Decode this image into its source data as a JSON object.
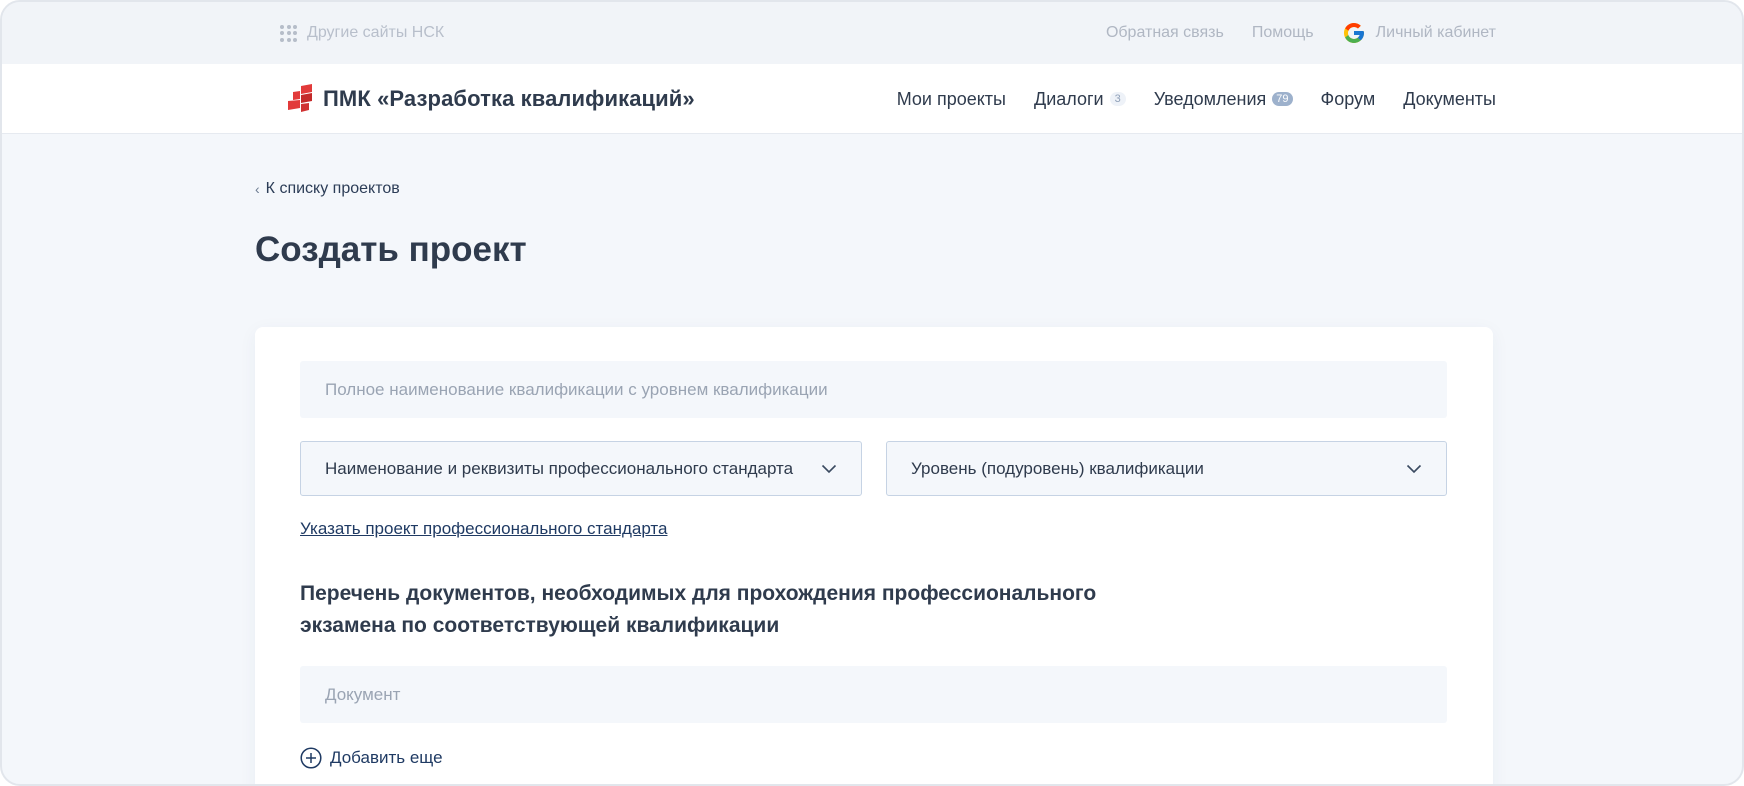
{
  "topbar": {
    "other_sites": "Другие сайты НСК",
    "feedback": "Обратная связь",
    "help": "Помощь",
    "account": "Личный кабинет"
  },
  "header": {
    "brand": "ПМК «Разработка квалификаций»",
    "nav": {
      "projects": "Мои проекты",
      "dialogs": "Диалоги",
      "dialogs_count": "3",
      "notifications": "Уведомления",
      "notifications_count": "79",
      "forum": "Форум",
      "documents": "Документы"
    }
  },
  "main": {
    "back_link": "К списку проектов",
    "title": "Создать проект"
  },
  "form": {
    "qualification_placeholder": "Полное наименование квалификации с уровнем квалификации",
    "standard_select": "Наименование и реквизиты профессионального стандарта",
    "level_select": "Уровень (подуровень) квалификации",
    "standard_link": "Указать проект профессионального стандарта",
    "documents_title": "Перечень документов, необходимых для прохождения профессионального экзамена по соответствующей квалификации",
    "document_placeholder": "Документ",
    "add_more": "Добавить еще"
  },
  "colors": {
    "accent_dark": "#1f3a63",
    "text": "#2f3b4d",
    "logo_red": "#e23a3a",
    "page_bg": "#f4f7fb"
  },
  "icons": {
    "apps": "grid-dots-icon",
    "account": "google-icon",
    "logo": "brand-logo-icon",
    "back": "chevron-left-icon",
    "select": "chevron-down-icon",
    "add": "plus-circle-icon"
  }
}
